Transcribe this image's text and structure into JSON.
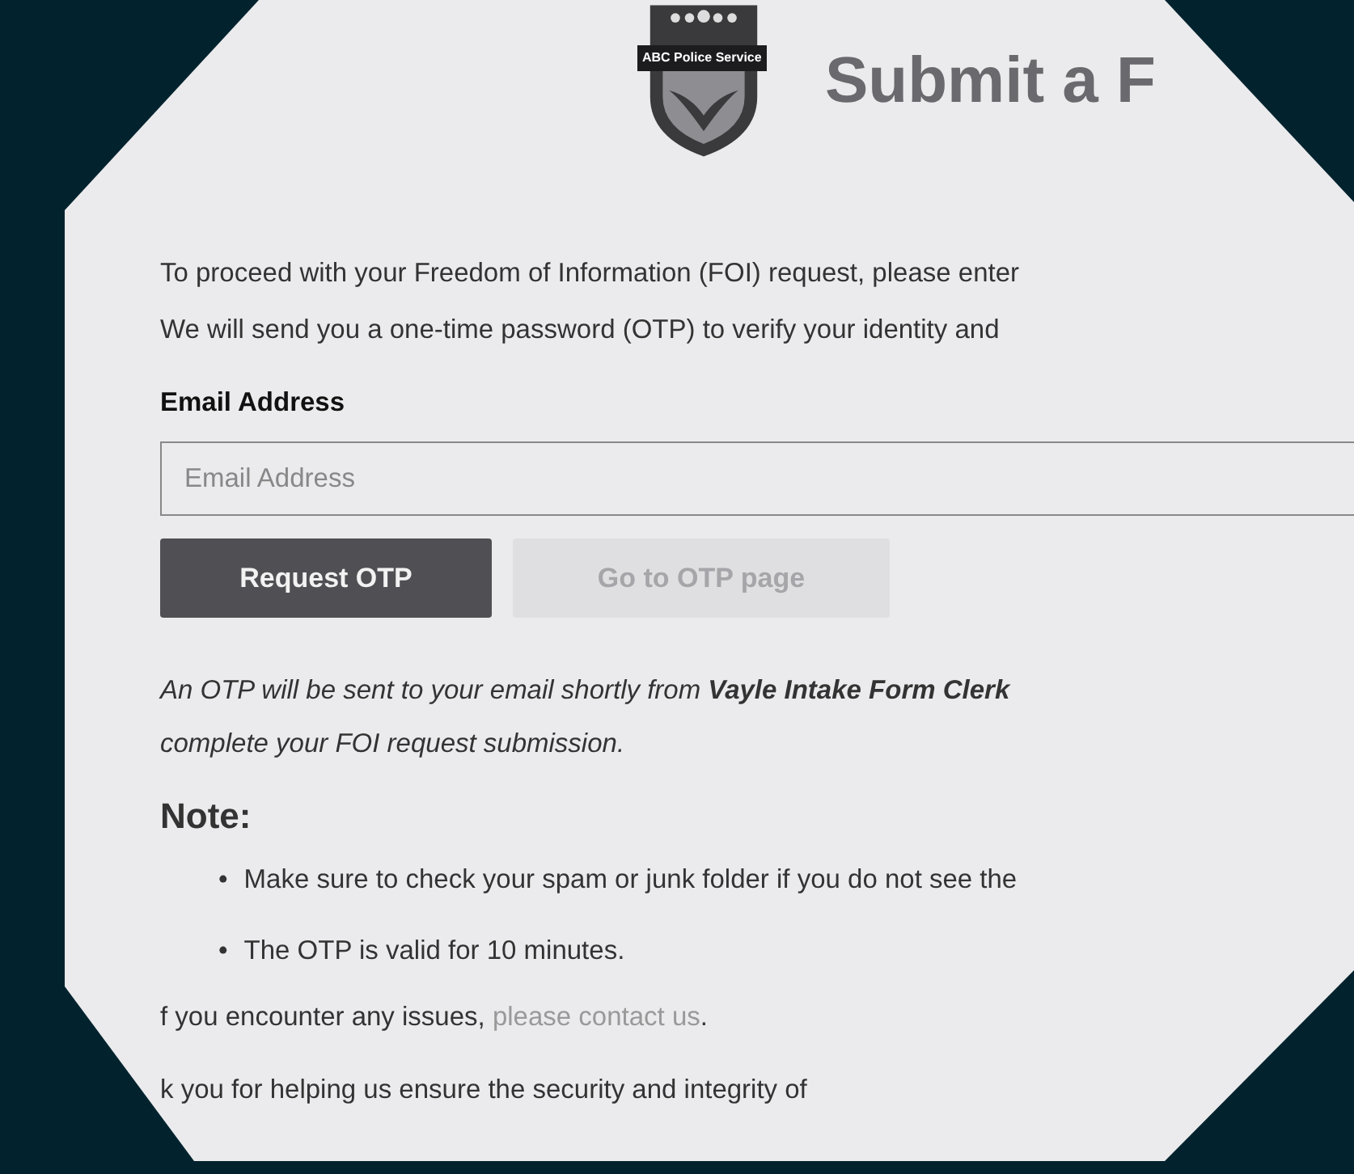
{
  "header": {
    "logo_text": "ABC Police Service",
    "title": "Submit a F"
  },
  "intro": [
    "To proceed with your Freedom of Information (FOI) request, please enter",
    "We will send you a one-time password (OTP) to verify your identity and"
  ],
  "email": {
    "label": "Email Address",
    "placeholder": "Email Address"
  },
  "buttons": [
    {
      "label": "Request OTP",
      "disabled": false
    },
    {
      "label": "Go to OTP page",
      "disabled": true
    }
  ],
  "notice": [
    "An OTP will be sent to your email shortly from **Vayle Intake Form Clerk**",
    "complete your FOI request submission."
  ],
  "note": {
    "heading": "Note:",
    "items": [
      {
        "bullet": "•",
        "text": "Make sure to check your spam or junk folder if you do not see the"
      },
      {
        "bullet": "•",
        "text": "The OTP is valid for 10 minutes."
      }
    ]
  },
  "contact": {
    "text": "f you encounter any issues,",
    "link": "please contact us",
    "end": "."
  },
  "thanks": "k you for helping us ensure the security and integrity of"
}
